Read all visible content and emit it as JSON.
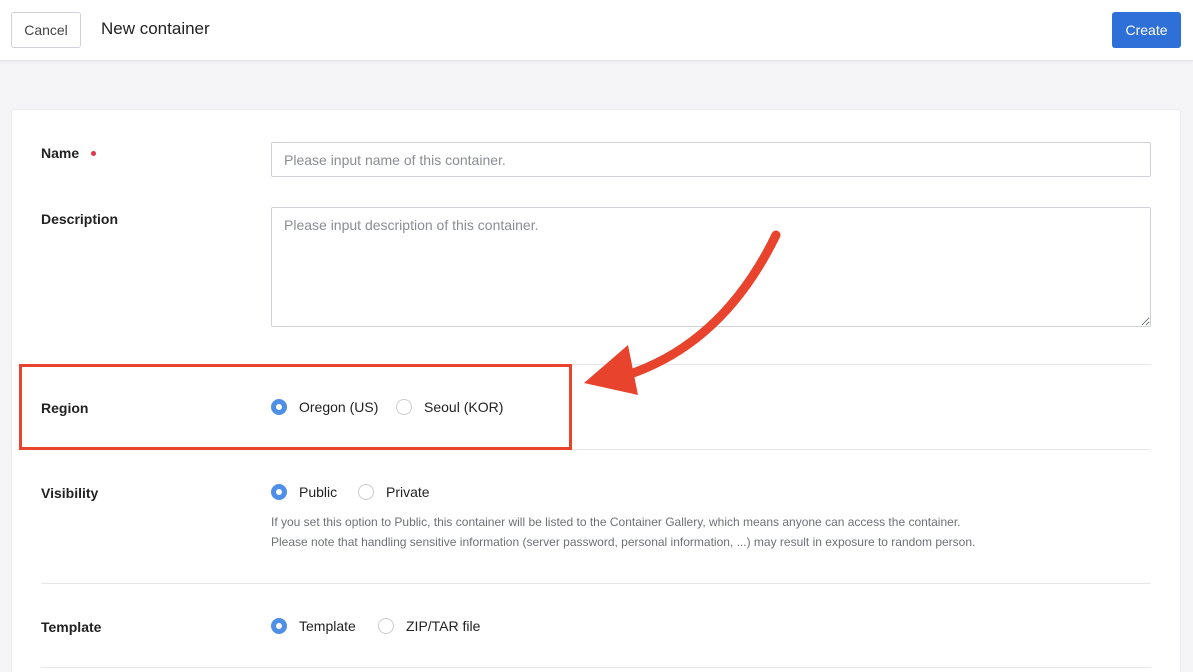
{
  "topbar": {
    "cancel_label": "Cancel",
    "title": "New container",
    "create_label": "Create"
  },
  "form": {
    "name": {
      "label": "Name",
      "placeholder": "Please input name of this container."
    },
    "description": {
      "label": "Description",
      "placeholder": "Please input description of this container."
    },
    "region": {
      "label": "Region",
      "options": [
        {
          "label": "Oregon (US)",
          "checked": true
        },
        {
          "label": "Seoul (KOR)",
          "checked": false
        }
      ]
    },
    "visibility": {
      "label": "Visibility",
      "options": [
        {
          "label": "Public",
          "checked": true
        },
        {
          "label": "Private",
          "checked": false
        }
      ],
      "help_lines": [
        "If you set this option to Public, this container will be listed to the Container Gallery, which means anyone can access the container.",
        "Please note that handling sensitive information (server password, personal information, ...) may result in exposure to random person."
      ]
    },
    "template": {
      "label": "Template",
      "options": [
        {
          "label": "Template",
          "checked": true
        },
        {
          "label": "ZIP/TAR file",
          "checked": false
        }
      ]
    }
  },
  "colors": {
    "primary": "#2e6fd8",
    "radio_checked": "#4f8fe8",
    "required": "#e0364a",
    "annotation": "#e8432d"
  }
}
